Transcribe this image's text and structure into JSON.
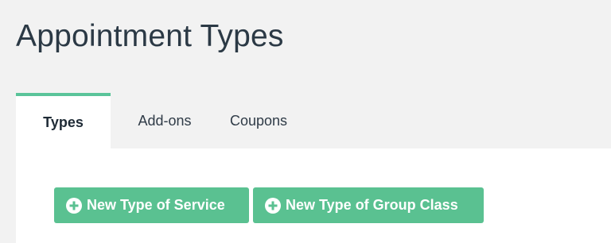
{
  "page": {
    "title": "Appointment Types"
  },
  "tabs": [
    {
      "label": "Types",
      "active": true
    },
    {
      "label": "Add-ons",
      "active": false
    },
    {
      "label": "Coupons",
      "active": false
    }
  ],
  "actions": {
    "new_service_label": "New Type of Service",
    "new_group_class_label": "New Type of Group Class",
    "icon": "plus-circle-icon"
  },
  "colors": {
    "accent": "#5ac191",
    "active_tab_border": "#5ac49a",
    "background": "#f2f2f2",
    "panel": "#ffffff",
    "text": "#2b3945"
  }
}
